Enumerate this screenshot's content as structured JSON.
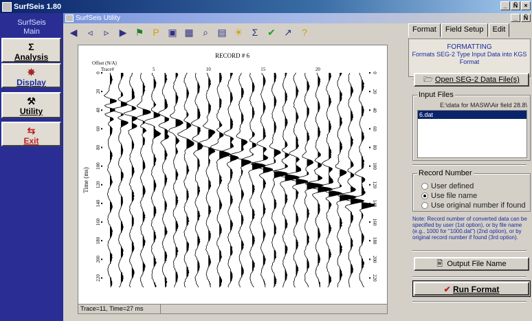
{
  "app": {
    "title": "SurfSeis 1.80",
    "window_controls": [
      "_",
      "Ñ",
      "×"
    ]
  },
  "left_nav": {
    "header_line1": "SurfSeis",
    "header_line2": "Main",
    "items": [
      {
        "icon": "sigma-icon",
        "glyph": "Σ",
        "label": "Analysis"
      },
      {
        "icon": "display-icon",
        "glyph": "✵",
        "label": "Display"
      },
      {
        "icon": "utility-icon",
        "glyph": "⚒",
        "label": "Utility"
      },
      {
        "icon": "exit-icon",
        "glyph": "⇆",
        "label": "Exit"
      }
    ]
  },
  "child_window": {
    "title": "SurfSeis Utility"
  },
  "toolbar": {
    "tools": [
      {
        "name": "arrow-left-icon",
        "glyph": "◀"
      },
      {
        "name": "step-back-icon",
        "glyph": "◃"
      },
      {
        "name": "step-forward-icon",
        "glyph": "▹"
      },
      {
        "name": "arrow-right-icon",
        "glyph": "▶"
      },
      {
        "name": "pick-icon",
        "glyph": "⚑"
      },
      {
        "name": "flag-icon",
        "glyph": "P"
      },
      {
        "name": "window-icon",
        "glyph": "▣"
      },
      {
        "name": "table-icon",
        "glyph": "▦"
      },
      {
        "name": "zoom-icon",
        "glyph": "⌕"
      },
      {
        "name": "monitor-icon",
        "glyph": "▤"
      },
      {
        "name": "bulb-icon",
        "glyph": "☀"
      },
      {
        "name": "sum-icon",
        "glyph": "Σ"
      },
      {
        "name": "check-icon",
        "glyph": "✔"
      },
      {
        "name": "context-help-icon",
        "glyph": "↗"
      },
      {
        "name": "help-icon",
        "glyph": "?"
      }
    ]
  },
  "plot": {
    "title": "RECORD # 6",
    "offset_label": "Offset (N/A)",
    "trace_label": "Trace#",
    "trace_ticks": [
      "5",
      "10",
      "15",
      "20"
    ],
    "y_label": "Time (ms)",
    "y_ticks": [
      "0",
      "20",
      "40",
      "60",
      "80",
      "100",
      "120",
      "140",
      "160",
      "180",
      "200",
      "220"
    ],
    "trace_count": 24,
    "time_max_ms": 230
  },
  "status_bar": {
    "text": "Trace=11, Time=27 ms"
  },
  "right_panel": {
    "tabs": [
      "Format",
      "Field Setup",
      "Edit"
    ],
    "format_header": "FORMATTING",
    "format_desc": "Formats SEG-2 Type Input Data into KGS Format",
    "open_button": "Open SEG-2 Data File(s)",
    "input_files_label": "Input Files",
    "input_path": "E:\\data for MASW\\Air field 28.8\\",
    "files": [
      "6.dat"
    ],
    "record_number_label": "Record Number",
    "options": [
      {
        "label": "User defined",
        "checked": false
      },
      {
        "label": "Use file name",
        "checked": true
      },
      {
        "label": "Use original number if found",
        "checked": false
      }
    ],
    "note": "Note:  Record number of converted data can be specified by user (1st option), or by file name (e.g., 1000 for \"1000.dat\") (2nd option), or by original record number if found (3rd option).",
    "output_button": "Output File Name",
    "run_button": "Run Format"
  }
}
